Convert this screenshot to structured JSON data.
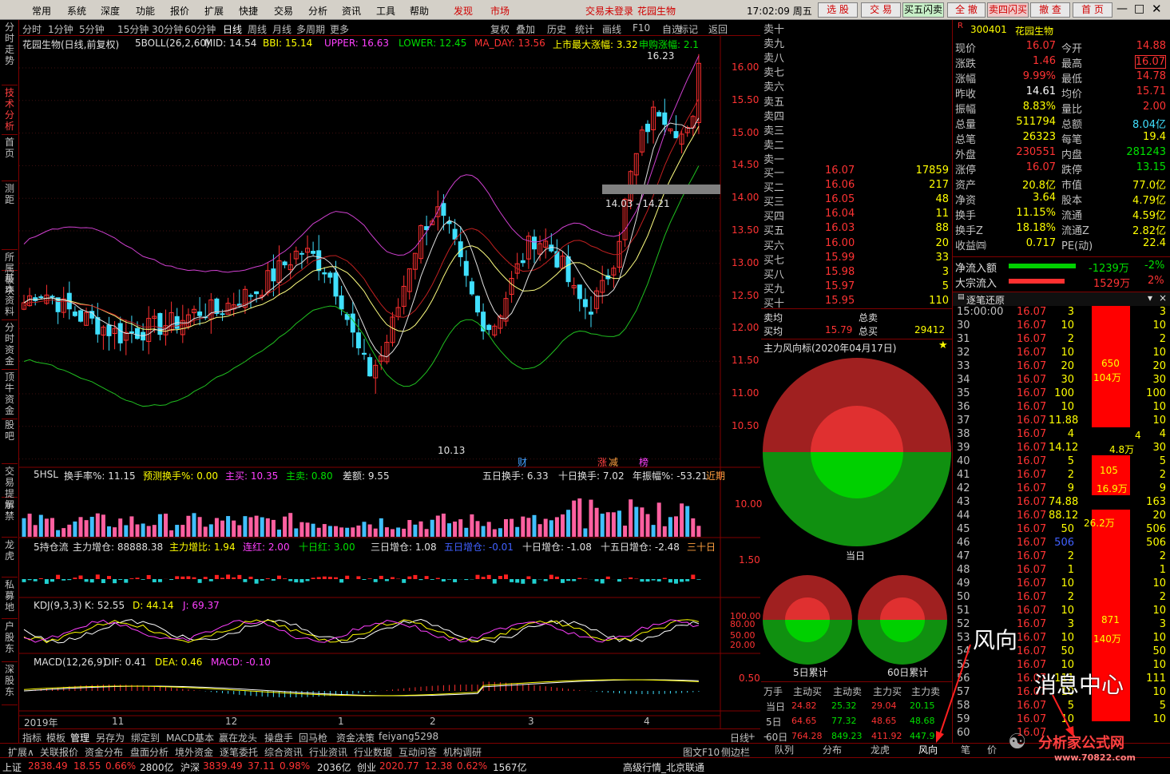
{
  "menu": {
    "items": [
      "常用",
      "系统",
      "深度",
      "功能",
      "报价",
      "扩展",
      "快捷",
      "交易",
      "分析",
      "资讯",
      "工具",
      "帮助"
    ],
    "faxian": "发现",
    "shichang": "市场",
    "login": "交易未登录",
    "stock_name": "花园生物",
    "time": "17:02:09 周五",
    "buttons": [
      "选 股",
      "交 易",
      "买五闪卖",
      "全 撤",
      "卖四闪买",
      "撤 查",
      "首 页"
    ]
  },
  "sidetabs": [
    "分时走势",
    "技术分析",
    "首页",
    "测距",
    "所属板块",
    "基本资料",
    "分时资金",
    "顶牛资金",
    "股吧",
    "交易提示",
    "解禁",
    "龙虎",
    "私募地",
    "户股东",
    "深股东"
  ],
  "periods": [
    "分时",
    "1分钟",
    "5分钟",
    "15分钟",
    "30分钟",
    "60分钟",
    "日线",
    "周线",
    "月线",
    "多周期",
    "更多"
  ],
  "period_tools": [
    "复权",
    "叠加",
    "历史",
    "统计",
    "画线",
    "F10",
    "自选",
    "返回"
  ],
  "main_chart": {
    "header": {
      "name": "花园生物(日线,前复权)",
      "ind": "5BOLL(26,2,60)",
      "mid": "MID: 14.54",
      "bbi": "BBI: 15.14",
      "upper": "UPPER: 16.63",
      "lower": "LOWER: 12.45",
      "ma": "MA_DAY: 13.56",
      "max_rise": "上市最大涨幅: 3.32",
      "subscribe": "申购涨幅: 2.1"
    },
    "y_ticks": [
      "16.00",
      "15.50",
      "15.00",
      "14.50",
      "14.00",
      "13.50",
      "13.00",
      "12.50",
      "12.00",
      "11.50",
      "11.00",
      "10.50"
    ],
    "hi_label": "16.23",
    "lo_label": "10.13",
    "range_label": "14.03 - 14.21",
    "markers": [
      "财",
      "涨",
      "减",
      "榜"
    ]
  },
  "hsl_panel": {
    "title": "5HSL",
    "rate": "换手率%: 11.15",
    "pred": "预测换手%: 0.00",
    "zhumai": "主买: 10.35",
    "zhumaichu": "主卖: 0.80",
    "cha": "差额: 9.55",
    "five": "五日换手: 6.33",
    "ten": "十日换手: 7.02",
    "year": "年振幅%: -53.21",
    "near": "近期",
    "y_tick": "10.00"
  },
  "cc_panel": {
    "title": "5持仓流",
    "zl": "主力增仓: 88888.38",
    "zlb": "主力增比: 1.94",
    "lh": "连红: 2.00",
    "sr": "十日红: 3.00",
    "d3": "三日增仓: 1.08",
    "d5": "五日增仓: -0.01",
    "d10": "十日增仓: -1.08",
    "d15": "十五日增仓: -2.48",
    "d30": "三十日",
    "y_tick": "1.50"
  },
  "kdj_panel": {
    "title": "KDJ(9,3,3)",
    "k": "K: 52.55",
    "d": "D: 44.14",
    "j": "J: 69.37",
    "y_ticks": [
      "100.00",
      "80.00",
      "50.00",
      "20.00"
    ]
  },
  "macd_panel": {
    "title": "MACD(12,26,9)",
    "dif": "DIF: 0.41",
    "dea": "DEA: 0.46",
    "macd": "MACD: -0.10",
    "y_tick": "0.50"
  },
  "x_labels": [
    "2019年",
    "11",
    "12",
    "1",
    "2",
    "3",
    "4"
  ],
  "bottom_tabs": [
    "指标",
    "模板",
    "管理",
    "另存为",
    "绑定到",
    "MACD基本",
    "赢在龙头",
    "操盘手",
    "回马枪",
    "资金决策",
    "feiyang5298"
  ],
  "bottom_right": [
    "日线",
    "+",
    "-"
  ],
  "toolbar2": [
    "扩展∧",
    "关联报价",
    "资金分布",
    "盘面分析",
    "境外资金",
    "逐笔委托",
    "综合资讯",
    "行业资讯",
    "行业数据",
    "互动问答",
    "机构调研"
  ],
  "toolbar2_right": [
    "图文F10",
    "侧边栏"
  ],
  "status": {
    "sh": "上证",
    "sh_val": "2838.49",
    "sh_chg": "18.55",
    "sh_pct": "0.66%",
    "sh_amt": "2800亿",
    "hs": "沪深",
    "hs_val": "3839.49",
    "hs_chg": "37.11",
    "hs_pct": "0.98%",
    "hs_amt": "2036亿",
    "cy": "创业",
    "cy_val": "2020.77",
    "cy_chg": "12.38",
    "cy_pct": "0.62%",
    "cy_amt": "1567亿",
    "feed": "高级行情_北京联通"
  },
  "orderbook": {
    "sell": [
      "卖十",
      "卖九",
      "卖八",
      "卖七",
      "卖六",
      "卖五",
      "卖四",
      "卖三",
      "卖二",
      "卖一"
    ],
    "buy": [
      {
        "l": "买一",
        "p": "16.07",
        "v": "17859"
      },
      {
        "l": "买二",
        "p": "16.06",
        "v": "217"
      },
      {
        "l": "买三",
        "p": "16.05",
        "v": "48"
      },
      {
        "l": "买四",
        "p": "16.04",
        "v": "11"
      },
      {
        "l": "买五",
        "p": "16.03",
        "v": "88"
      },
      {
        "l": "买六",
        "p": "16.00",
        "v": "20"
      },
      {
        "l": "买七",
        "p": "15.99",
        "v": "33"
      },
      {
        "l": "买八",
        "p": "15.98",
        "v": "3"
      },
      {
        "l": "买九",
        "p": "15.97",
        "v": "5"
      },
      {
        "l": "买十",
        "p": "15.95",
        "v": "110"
      }
    ],
    "avg_sell": "卖均",
    "total_sell": "总卖",
    "avg_buy": "买均",
    "avg_buy_p": "15.79",
    "total_buy": "总买",
    "total_buy_v": "29412"
  },
  "fengxiang": {
    "title": "主力风向标(2020年04月17日)",
    "today": "当日",
    "d5": "5日累计",
    "d60": "60日累计",
    "table_head": [
      "万手",
      "主动买",
      "主动卖",
      "主力买",
      "主力卖"
    ],
    "rows": [
      {
        "l": "当日",
        "v": [
          "24.82",
          "25.32",
          "29.04",
          "20.15"
        ]
      },
      {
        "l": "5日",
        "v": [
          "64.65",
          "77.32",
          "48.65",
          "48.68"
        ]
      },
      {
        "l": "60日",
        "v": [
          "764.28",
          "849.23",
          "411.92",
          "447.9"
        ]
      }
    ]
  },
  "right_tabs": [
    "队列",
    "分布",
    "龙虎",
    "风向",
    "笔",
    "价"
  ],
  "quote": {
    "code": "300401",
    "name": "花园生物",
    "rows": [
      {
        "a": "现价",
        "b": "16.07",
        "c": "今开",
        "d": "14.88"
      },
      {
        "a": "涨跌",
        "b": "1.46",
        "c": "最高",
        "d": "16.07"
      },
      {
        "a": "涨幅",
        "b": "9.99%",
        "c": "最低",
        "d": "14.78"
      },
      {
        "a": "昨收",
        "b": "14.61",
        "c": "均价",
        "d": "15.71"
      },
      {
        "a": "振幅",
        "b": "8.83%",
        "c": "量比",
        "d": "2.00"
      },
      {
        "a": "总量",
        "b": "511794",
        "c": "总额",
        "d": "8.04亿"
      },
      {
        "a": "总笔",
        "b": "26323",
        "c": "每笔",
        "d": "19.4"
      },
      {
        "a": "外盘",
        "b": "230551",
        "c": "内盘",
        "d": "281243"
      },
      {
        "a": "涨停",
        "b": "16.07",
        "c": "跌停",
        "d": "13.15"
      },
      {
        "a": "资产",
        "b": "20.8亿",
        "c": "市值",
        "d": "77.0亿"
      },
      {
        "a": "净资",
        "b": "3.64",
        "c": "股本",
        "d": "4.79亿"
      },
      {
        "a": "换手",
        "b": "11.15%",
        "c": "流通",
        "d": "4.59亿"
      },
      {
        "a": "换手Z",
        "b": "18.18%",
        "c": "流通Z",
        "d": "2.82亿"
      },
      {
        "a": "收益㈣",
        "b": "0.717",
        "c": "PE(动)",
        "d": "22.4"
      }
    ],
    "net_in": "净流入额",
    "net_in_v": "-1239万",
    "net_in_p": "-2%",
    "big": "大宗流入",
    "big_v": "1529万",
    "big_p": "2%"
  },
  "ticks": {
    "title": "逐笔还原",
    "rows": [
      [
        "15:00:00",
        "16.07",
        "3",
        "3"
      ],
      [
        "30",
        "16.07",
        "10",
        "10"
      ],
      [
        "31",
        "16.07",
        "2",
        "2"
      ],
      [
        "32",
        "16.07",
        "10",
        "10"
      ],
      [
        "33",
        "16.07",
        "20",
        "20"
      ],
      [
        "34",
        "16.07",
        "30",
        "30"
      ],
      [
        "35",
        "16.07",
        "100",
        "100"
      ],
      [
        "36",
        "16.07",
        "10",
        "10"
      ],
      [
        "37",
        "16.07",
        "11.88",
        "10"
      ],
      [
        "38",
        "16.07",
        "4",
        "4"
      ],
      [
        "39",
        "16.07",
        "14.12",
        "30"
      ],
      [
        "40",
        "16.07",
        "5",
        "5"
      ],
      [
        "41",
        "16.07",
        "2",
        "2"
      ],
      [
        "42",
        "16.07",
        "9",
        "9"
      ],
      [
        "43",
        "16.07",
        "74.88",
        "163"
      ],
      [
        "44",
        "16.07",
        "88.12",
        "20"
      ],
      [
        "45",
        "16.07",
        "50",
        "506"
      ],
      [
        "46",
        "16.07",
        "506",
        "506"
      ],
      [
        "47",
        "16.07",
        "2",
        "2"
      ],
      [
        "48",
        "16.07",
        "1",
        "1"
      ],
      [
        "49",
        "16.07",
        "10",
        "10"
      ],
      [
        "50",
        "16.07",
        "2",
        "2"
      ],
      [
        "51",
        "16.07",
        "10",
        "10"
      ],
      [
        "52",
        "16.07",
        "3",
        "3"
      ],
      [
        "53",
        "16.07",
        "10",
        "10"
      ],
      [
        "54",
        "16.07",
        "50",
        "50"
      ],
      [
        "55",
        "16.07",
        "10",
        "10"
      ],
      [
        "56",
        "16.07",
        "111",
        "111"
      ],
      [
        "57",
        "16.07",
        "10",
        "10"
      ],
      [
        "58",
        "16.07",
        "5",
        "5"
      ],
      [
        "59",
        "16.07",
        "10",
        "10"
      ],
      [
        "60",
        "16.07",
        "",
        ""
      ]
    ],
    "bar_labels": [
      {
        "a": "650",
        "b": "104万"
      },
      {
        "a": "105",
        "b": "16.9万"
      },
      {
        "a": "871",
        "b": "140万"
      }
    ],
    "side_labels": [
      "4",
      "4.8万",
      "26.2万"
    ]
  },
  "annotations": {
    "fengxiang": "风向",
    "news": "消息中心",
    "watermark": "分析家公式网",
    "watermark_url": "www.70822.com"
  }
}
